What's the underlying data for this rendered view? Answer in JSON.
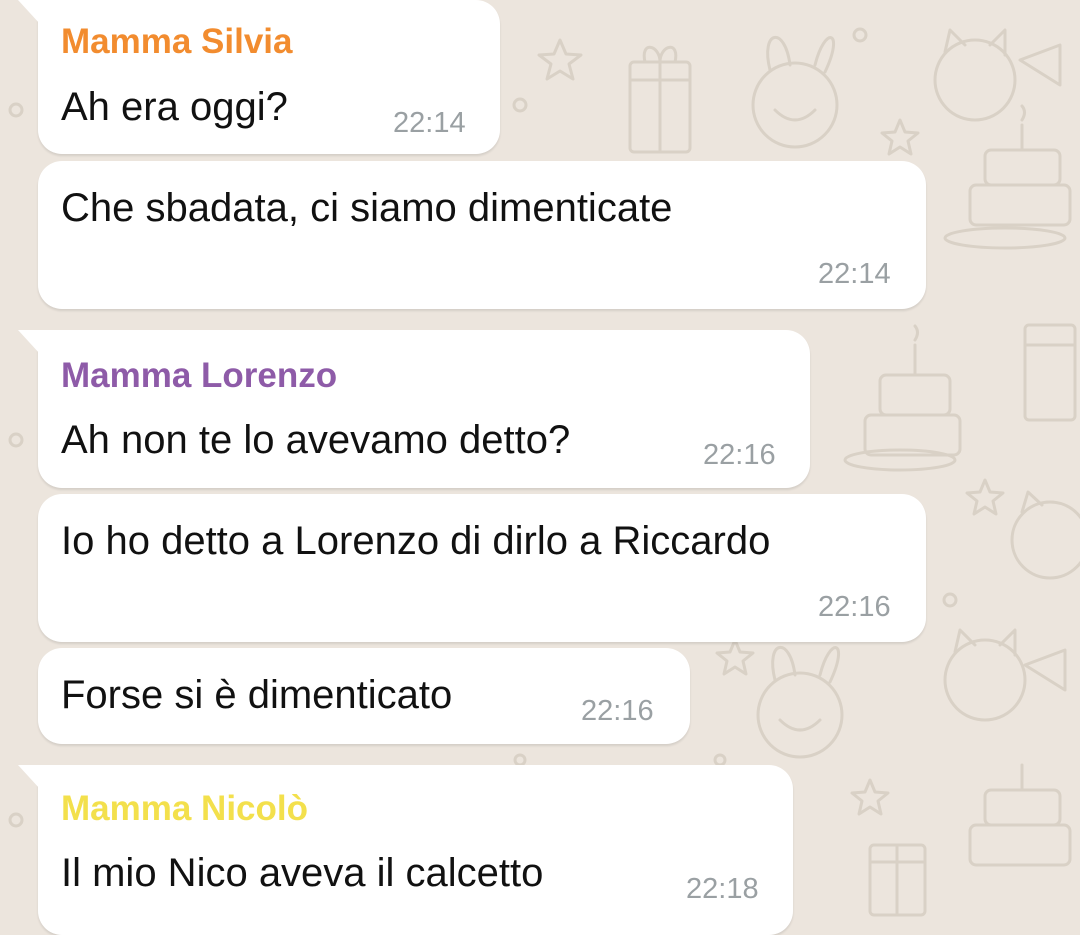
{
  "colors": {
    "bubble": "#ffffff",
    "wallpaper": "#ece5dd",
    "text": "#111111",
    "timestamp": "#9aa0a3"
  },
  "messages": [
    {
      "sender": "Mamma Silvia",
      "sender_color": "#f28c2f",
      "text": "Ah era oggi?",
      "time": "22:14"
    },
    {
      "text": "Che sbadata, ci siamo dimenticate",
      "time": "22:14"
    },
    {
      "sender": "Mamma Lorenzo",
      "sender_color": "#8e5ba8",
      "text": "Ah non te lo avevamo detto?",
      "time": "22:16"
    },
    {
      "text": "Io ho detto a Lorenzo di dirlo a Riccardo",
      "time": "22:16"
    },
    {
      "text": "Forse si è dimenticato",
      "time": "22:16"
    },
    {
      "sender": "Mamma Nicolò",
      "sender_color": "#f3e04c",
      "text": "Il mio Nico aveva il calcetto",
      "time": "22:18"
    }
  ]
}
